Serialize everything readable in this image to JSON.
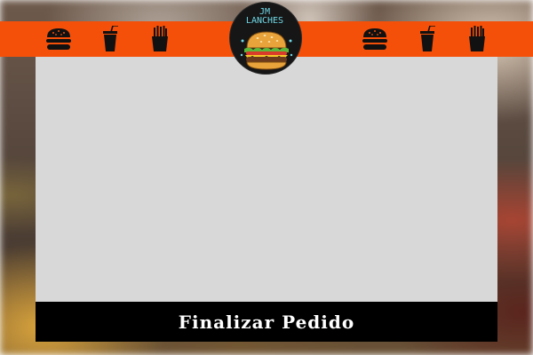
{
  "logo": {
    "line1": "JM",
    "line2": "LANCHES"
  },
  "nav": {
    "left_icons": [
      "burger-icon",
      "drink-cup-icon",
      "fries-icon"
    ],
    "right_icons": [
      "burger-icon",
      "drink-cup-icon",
      "fries-icon"
    ]
  },
  "footer": {
    "button_label": "Finalizar Pedido"
  },
  "colors": {
    "top_bar": "#f5500a",
    "panel": "#d8d8d8",
    "footer": "#000000",
    "logo_text": "#6fd8e6"
  }
}
